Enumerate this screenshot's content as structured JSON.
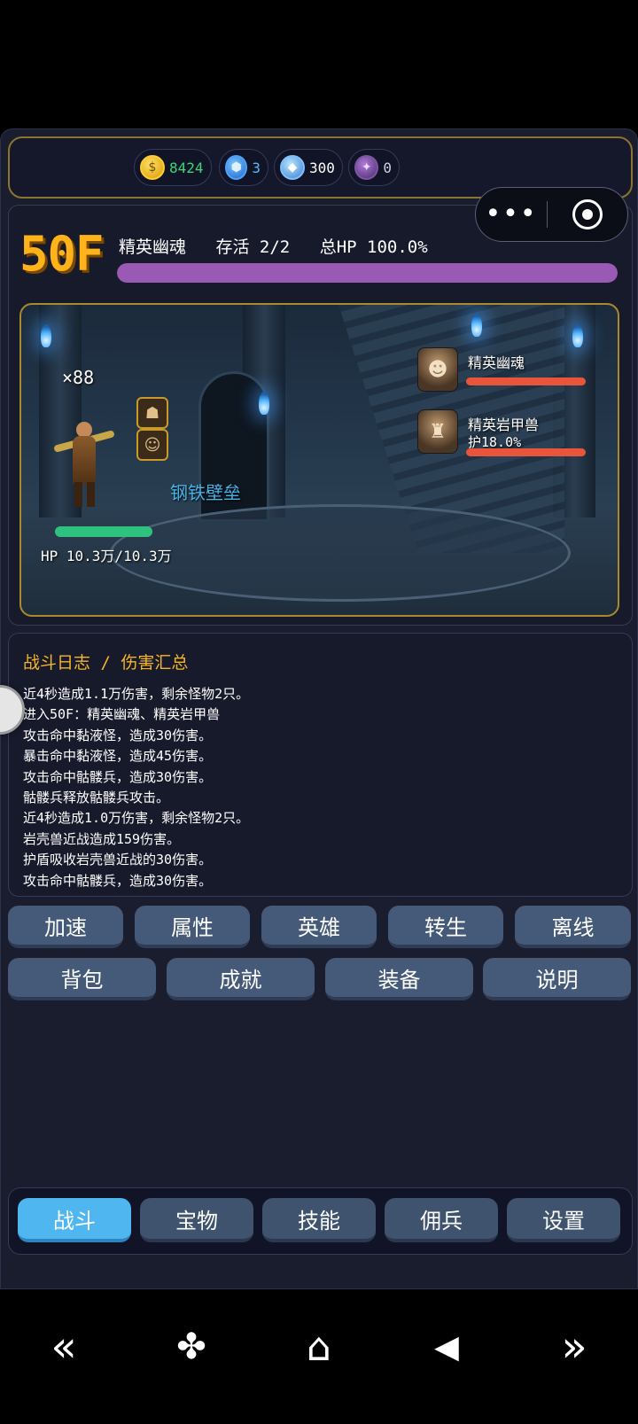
{
  "currency": [
    {
      "icon": "gold-coin-icon",
      "symbol": "$",
      "value": "8424",
      "color": "#3fd37a"
    },
    {
      "icon": "blue-gem-icon",
      "symbol": "⬢",
      "value": "3",
      "color": "#57b8ff"
    },
    {
      "icon": "diamond-icon",
      "symbol": "◆",
      "value": "300",
      "color": "#ffffff"
    },
    {
      "icon": "purple-crystal-icon",
      "symbol": "✦",
      "value": "0",
      "color": "#cfcfe0"
    }
  ],
  "capsule": {
    "more": "•••"
  },
  "battle": {
    "floor": "50F",
    "monster_name": "精英幽魂",
    "alive": "存活 2/2",
    "total_hp": "总HP 100.0%",
    "total_hp_fraction": 1.0,
    "kill_count": "×88",
    "buff_text": "钢铁壁垒",
    "hero_hp_text": "HP 10.3万/10.3万",
    "hero_hp_fraction": 1.0,
    "enemies": [
      {
        "name": "精英幽魂",
        "shield": "",
        "hp_fraction": 1.0,
        "icon": "ghost-portrait-icon"
      },
      {
        "name": "精英岩甲兽",
        "shield": "护18.0%",
        "hp_fraction": 1.0,
        "icon": "rock-beast-portrait-icon"
      }
    ]
  },
  "log": {
    "title": "战斗日志 / 伤害汇总",
    "lines": [
      "近4秒造成1.1万伤害，剩余怪物2只。",
      "进入50F：精英幽魂、精英岩甲兽",
      "攻击命中黏液怪，造成30伤害。",
      "暴击命中黏液怪，造成45伤害。",
      "攻击命中骷髅兵，造成30伤害。",
      "骷髅兵释放骷髅兵攻击。",
      "近4秒造成1.0万伤害，剩余怪物2只。",
      "岩壳兽近战造成159伤害。",
      "护盾吸收岩壳兽近战的30伤害。",
      "攻击命中骷髅兵，造成30伤害。"
    ]
  },
  "actions_row1": [
    "加速",
    "属性",
    "英雄",
    "转生",
    "离线"
  ],
  "actions_row2": [
    "背包",
    "成就",
    "装备",
    "说明"
  ],
  "tabs": [
    "战斗",
    "宝物",
    "技能",
    "佣兵",
    "设置"
  ],
  "active_tab": 0,
  "nav": {
    "back_double": "«",
    "apps": "✤",
    "home": "⌂",
    "back": "◀",
    "forward_double": "»"
  }
}
